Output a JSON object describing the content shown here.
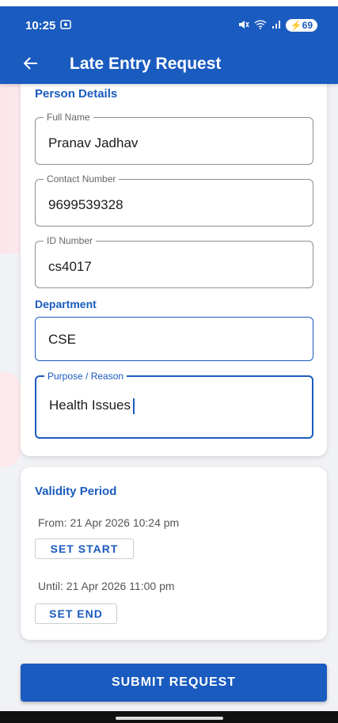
{
  "status_bar": {
    "time": "10:25",
    "battery": "69",
    "screen_icon": "screenshot-icon",
    "mute_icon": "mute-icon",
    "wifi_icon": "wifi-icon",
    "signal_icon": "signal-icon"
  },
  "app_bar": {
    "title": "Late Entry Request",
    "back_icon": "back-arrow-icon"
  },
  "person": {
    "section_title": "Person Details",
    "full_name_label": "Full Name",
    "full_name_value": "Pranav Jadhav",
    "contact_label": "Contact Number",
    "contact_value": "9699539328",
    "id_label": "ID Number",
    "id_value": "cs4017",
    "department_title": "Department",
    "department_value": "CSE",
    "purpose_label": "Purpose / Reason",
    "purpose_value": "Health Issues"
  },
  "validity": {
    "section_title": "Validity Period",
    "from_text": "From: 21 Apr 2026 10:24 pm",
    "set_start_label": "SET START",
    "until_text": "Until: 21 Apr 2026 11:00 pm",
    "set_end_label": "SET END"
  },
  "submit_label": "SUBMIT REQUEST",
  "colors": {
    "primary": "#1a5bbf",
    "background": "#f1f2f6"
  }
}
